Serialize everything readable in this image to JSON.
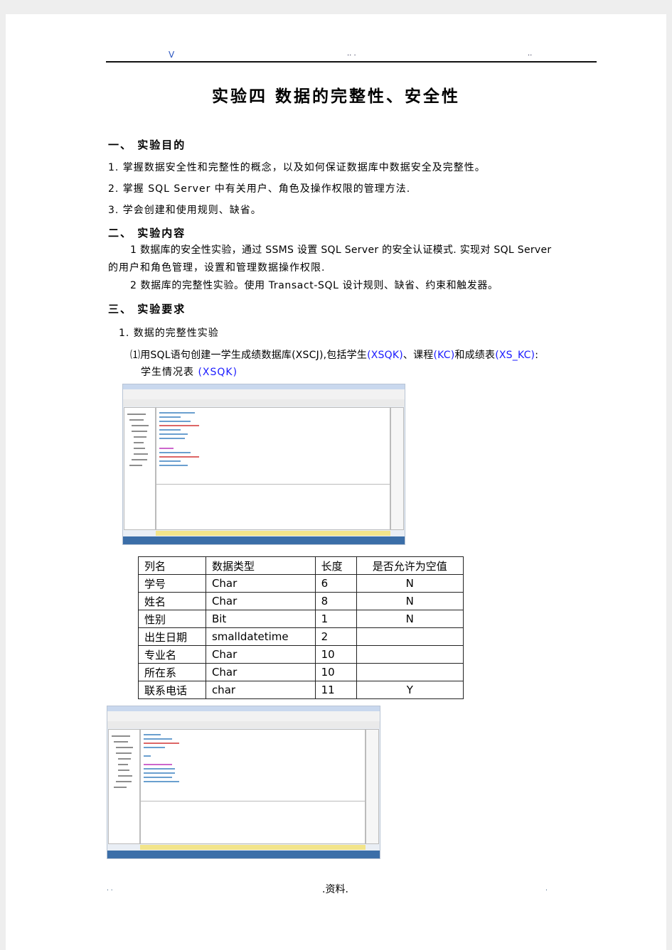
{
  "header": {
    "left_mark": "V",
    "mid_mark": "..  .",
    "right_mark": ".."
  },
  "title": "实验四   数据的完整性、安全性",
  "sections": [
    {
      "heading": "一、  实验目的",
      "items": [
        "1.  掌握数据安全性和完整性的概念，以及如何保证数据库中数据安全及完整性。",
        "2.  掌握 SQL Server 中有关用户、角色及操作权限的管理方法.",
        "3.  学会创建和使用规则、缺省。"
      ]
    },
    {
      "heading": "二、  实验内容",
      "items": [
        "1 数据库的安全性实验，通过 SSMS 设置 SQL Server 的安全认证模式. 实现对 SQL Server",
        "的用户和角色管理，设置和管理数据操作权限.",
        "2 数据库的完整性实验。使用 Transact-SQL 设计规则、缺省、约束和触发器。"
      ]
    },
    {
      "heading": "三、  实验要求",
      "sub_heading": "1.  数据的完整性实验",
      "task_prefix": "⑴用SQL语句创建一学生成绩数据库(XSCJ),包括学生",
      "task_xsqk": "(XSQK)",
      "task_mid1": "、课程",
      "task_kc": "(KC)",
      "task_mid2": "和成绩表",
      "task_xskc": "(XS_KC)",
      "task_end": ":",
      "table_label": "学生情况表",
      "table_label_code": "(XSQK)"
    }
  ],
  "table": {
    "headers": [
      "列名",
      "数据类型",
      "长度",
      "是否允许为空值"
    ],
    "rows": [
      [
        "学号",
        "Char",
        "6",
        "N"
      ],
      [
        "姓名",
        "Char",
        "8",
        "N"
      ],
      [
        "性别",
        "Bit",
        "1",
        "N"
      ],
      [
        "出生日期",
        "smalldatetime",
        "2",
        ""
      ],
      [
        "专业名",
        "Char",
        "10",
        ""
      ],
      [
        "所在系",
        "Char",
        "10",
        ""
      ],
      [
        "联系电话",
        "char",
        "11",
        "Y"
      ]
    ]
  },
  "footer": {
    "left": ". .",
    "center": ".资料.",
    "right": "."
  },
  "colors": {
    "link": "#1a1aff",
    "rule": "#111111"
  }
}
